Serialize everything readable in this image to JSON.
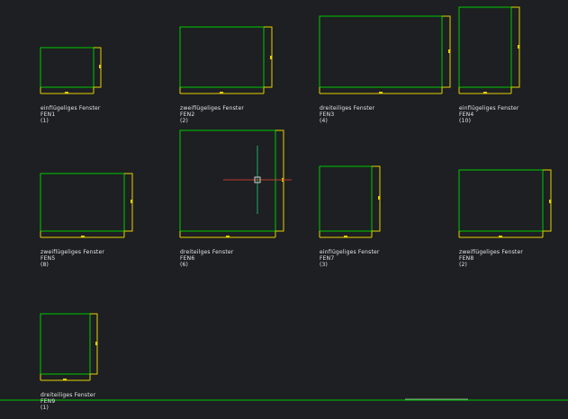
{
  "windows": [
    {
      "type": "einflügeliges Fenster",
      "code": "FEN1",
      "count": "(1)"
    },
    {
      "type": "zweiflügeliges Fenster",
      "code": "FEN2",
      "count": "(2)"
    },
    {
      "type": "dreiteiliges Fenster",
      "code": "FEN3",
      "count": "(4)"
    },
    {
      "type": "einflügeliges Fenster",
      "code": "FEN4",
      "count": "(10)"
    },
    {
      "type": "zweiflügeliges Fenster",
      "code": "FEN5",
      "count": "(8)"
    },
    {
      "type": "dreiteilges Fenster",
      "code": "FEN6",
      "count": "(6)"
    },
    {
      "type": "einflügeliges Fenster",
      "code": "FEN7",
      "count": "(3)"
    },
    {
      "type": "zweiflügeliges Fenster",
      "code": "FEN8",
      "count": "(2)"
    },
    {
      "type": "dreiteiliges Fenster",
      "code": "FEN9",
      "count": "(1)"
    }
  ],
  "colors": {
    "background": "#1d1f22",
    "window_outline": "#00c800",
    "frame_outline": "#e6d000",
    "text": "#e8e8e8",
    "crosshair_x": "#c0392b",
    "crosshair_y": "#1fa86a"
  },
  "icons": {
    "crosshair": "crosshair-cursor-icon"
  }
}
